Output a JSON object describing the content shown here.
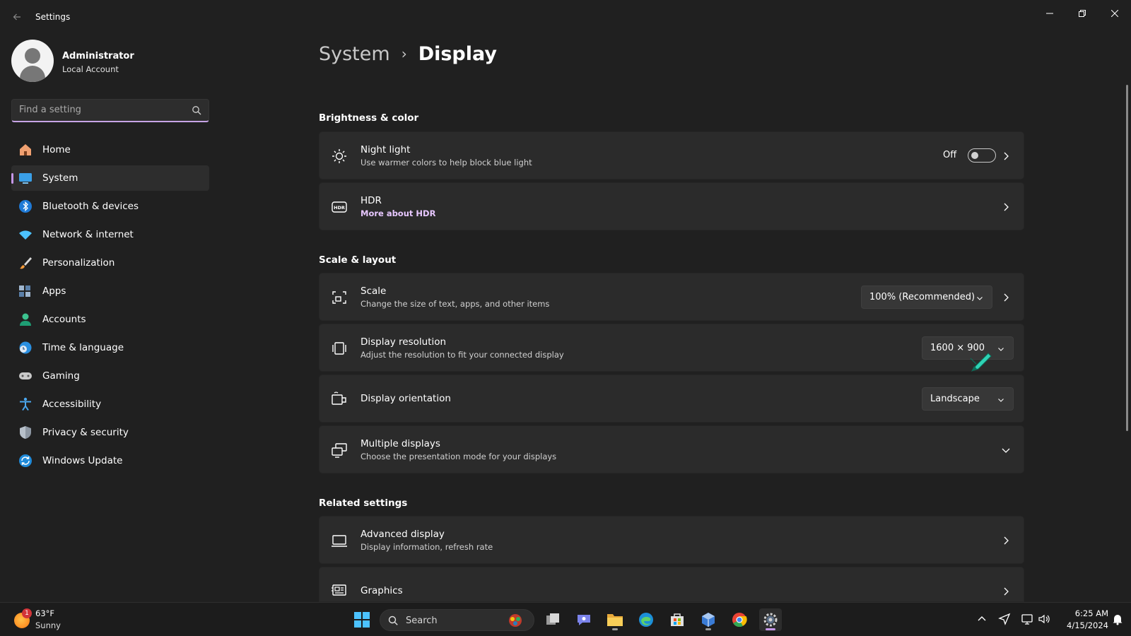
{
  "window": {
    "title": "Settings",
    "back_icon": "back-arrow-icon",
    "controls": {
      "minimize": "—",
      "restore": "❐",
      "close": "✕"
    }
  },
  "profile": {
    "name": "Administrator",
    "account_type": "Local Account"
  },
  "search": {
    "placeholder": "Find a setting",
    "value": ""
  },
  "sidebar": {
    "items": [
      {
        "label": "Home",
        "icon": "home-icon",
        "active": false
      },
      {
        "label": "System",
        "icon": "system-monitor-icon",
        "active": true
      },
      {
        "label": "Bluetooth & devices",
        "icon": "bluetooth-icon",
        "active": false
      },
      {
        "label": "Network & internet",
        "icon": "wifi-icon",
        "active": false
      },
      {
        "label": "Personalization",
        "icon": "brush-icon",
        "active": false
      },
      {
        "label": "Apps",
        "icon": "apps-icon",
        "active": false
      },
      {
        "label": "Accounts",
        "icon": "accounts-icon",
        "active": false
      },
      {
        "label": "Time & language",
        "icon": "globe-clock-icon",
        "active": false
      },
      {
        "label": "Gaming",
        "icon": "gamepad-icon",
        "active": false
      },
      {
        "label": "Accessibility",
        "icon": "accessibility-icon",
        "active": false
      },
      {
        "label": "Privacy & security",
        "icon": "shield-icon",
        "active": false
      },
      {
        "label": "Windows Update",
        "icon": "update-icon",
        "active": false
      }
    ]
  },
  "breadcrumb": {
    "parent": "System",
    "separator": "›",
    "current": "Display"
  },
  "sections": {
    "brightness": {
      "title": "Brightness & color",
      "night_light": {
        "title": "Night light",
        "subtitle": "Use warmer colors to help block blue light",
        "toggle_state": "Off"
      },
      "hdr": {
        "title": "HDR",
        "link": "More about HDR"
      }
    },
    "scale_layout": {
      "title": "Scale & layout",
      "scale": {
        "title": "Scale",
        "subtitle": "Change the size of text, apps, and other items",
        "value": "100% (Recommended)"
      },
      "resolution": {
        "title": "Display resolution",
        "subtitle": "Adjust the resolution to fit your connected display",
        "value": "1600 × 900"
      },
      "orientation": {
        "title": "Display orientation",
        "value": "Landscape"
      },
      "multiple": {
        "title": "Multiple displays",
        "subtitle": "Choose the presentation mode for your displays"
      }
    },
    "related": {
      "title": "Related settings",
      "advanced": {
        "title": "Advanced display",
        "subtitle": "Display information, refresh rate"
      },
      "graphics": {
        "title": "Graphics"
      }
    }
  },
  "taskbar": {
    "weather": {
      "temp": "63°F",
      "condition": "Sunny",
      "badge": "1"
    },
    "search_label": "Search",
    "clock": {
      "time": "6:25 AM",
      "date": "4/15/2024"
    }
  },
  "colors": {
    "accent": "#c597e8",
    "background": "#202020",
    "card": "#2b2b2b",
    "link": "#e7c7ff"
  }
}
